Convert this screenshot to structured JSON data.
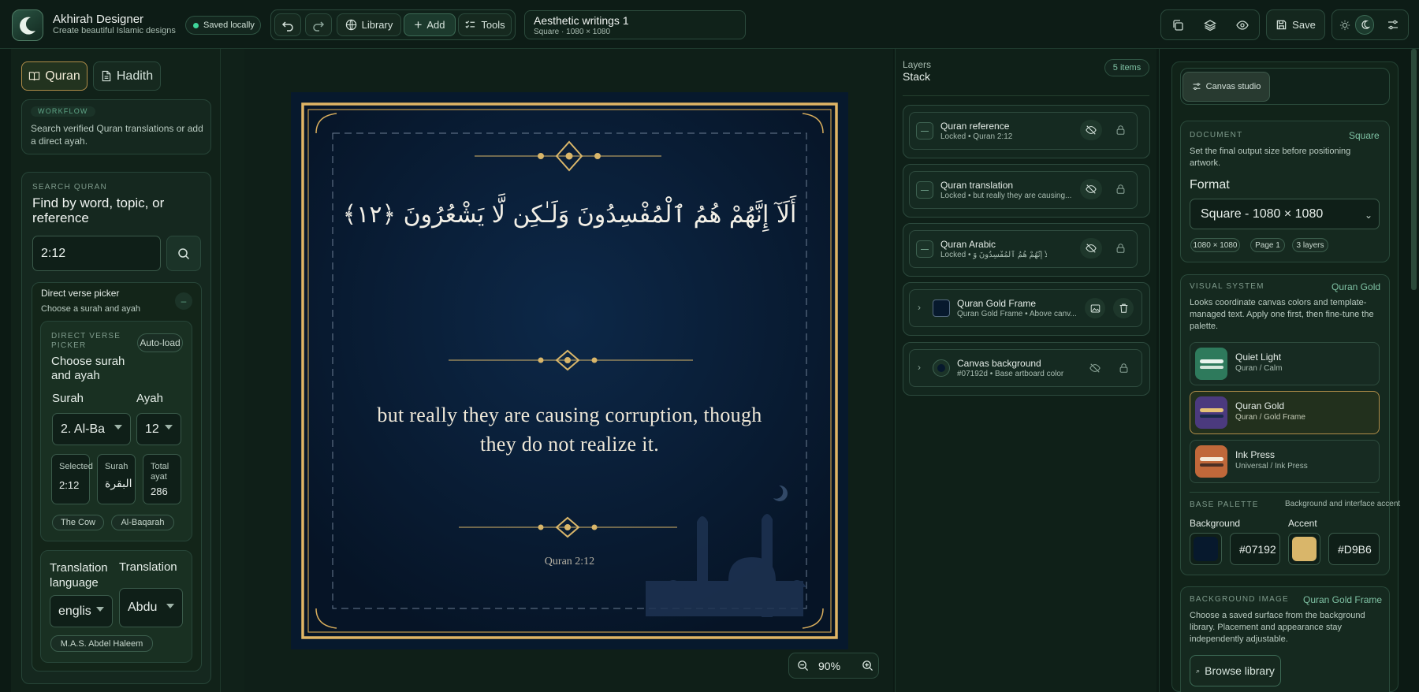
{
  "app": {
    "name": "Akhirah Designer",
    "tagline": "Create beautiful Islamic designs",
    "saved": "Saved locally"
  },
  "toolbar": {
    "library": "Library",
    "add": "Add",
    "tools": "Tools",
    "save": "Save"
  },
  "document": {
    "title": "Aesthetic writings 1",
    "meta": "Square · 1080 × 1080"
  },
  "left": {
    "tabs": [
      "Quran",
      "Hadith"
    ],
    "workflow": {
      "cap": "WORKFLOW",
      "text": "Search verified Quran translations or add a direct ayah."
    },
    "search": {
      "cap": "SEARCH QURAN",
      "title": "Find by word, topic, or reference",
      "value": "2:12"
    },
    "picker": {
      "title": "Direct verse picker",
      "sub": "Choose a surah and ayah",
      "collapse": "–",
      "inner_cap": "DIRECT VERSE PICKER",
      "inner_title": "Choose surah and ayah",
      "autoload": "Auto-load",
      "surah_label": "Surah",
      "ayah_label": "Ayah",
      "surah_value": "2. Al-Ba",
      "ayah_value": "12",
      "stats": [
        {
          "label": "Selected",
          "value": "2:12"
        },
        {
          "label": "Surah",
          "value": "البقرة"
        },
        {
          "label": "Total ayat",
          "value": "286"
        }
      ],
      "chips": [
        "The Cow",
        "Al-Baqarah"
      ]
    },
    "translation": {
      "lang_label": "Translation language",
      "tr_label": "Translation",
      "lang_value": "englis",
      "tr_value": "Abdu",
      "chip": "M.A.S. Abdel Haleem"
    }
  },
  "canvas": {
    "arabic": "أَلَآ إِنَّهُمْ هُمُ ٱلْمُفْسِدُونَ وَلَـٰكِن لَّا يَشْعُرُونَ ﴿١٢﴾",
    "translation_line1": "but really they are causing corruption, though",
    "translation_line2": "they do not realize it.",
    "reference": "Quran 2:12",
    "zoom": "90%",
    "colors": {
      "background": "#07192d",
      "gold": "#d9b66a"
    }
  },
  "layers": {
    "cap": "Layers",
    "title": "Stack",
    "count": "5 items",
    "items": [
      {
        "title": "Quran reference",
        "sub": "Locked • Quran 2:12"
      },
      {
        "title": "Quran translation",
        "sub": "Locked • but really they are causing..."
      },
      {
        "title": "Quran Arabic",
        "sub": "Locked • أَلَآ إِنَّهُمْ هُمُ ٱلْمُفْسِدُونَ وَ..."
      },
      {
        "title": "Quran Gold Frame",
        "sub": "Quran Gold Frame • Above canv..."
      },
      {
        "title": "Canvas background",
        "sub": "#07192d • Base artboard color"
      }
    ]
  },
  "right": {
    "tab": "Canvas studio",
    "document": {
      "cap": "DOCUMENT",
      "tag": "Square",
      "text": "Set the final output size before positioning artwork.",
      "format_label": "Format",
      "format_value": "Square - 1080 × 1080",
      "chips": [
        "1080 × 1080",
        "Page 1",
        "3 layers"
      ]
    },
    "visual": {
      "cap": "VISUAL SYSTEM",
      "tag": "Quran Gold",
      "text": "Looks coordinate canvas colors and template-managed text. Apply one first, then fine-tune the palette.",
      "themes": [
        {
          "name": "Quiet Light",
          "sub": "Quran / Calm"
        },
        {
          "name": "Quran Gold",
          "sub": "Quran / Gold Frame"
        },
        {
          "name": "Ink Press",
          "sub": "Universal / Ink Press"
        }
      ]
    },
    "palette": {
      "cap": "BASE PALETTE",
      "note": "Background and interface accent",
      "bg_label": "Background",
      "accent_label": "Accent",
      "bg_value": "#07192",
      "accent_value": "#D9B6"
    },
    "bgimage": {
      "cap": "BACKGROUND IMAGE",
      "tag": "Quran Gold Frame",
      "text": "Choose a saved surface from the background library. Placement and appearance stay independently adjustable.",
      "button": "Browse library"
    }
  }
}
